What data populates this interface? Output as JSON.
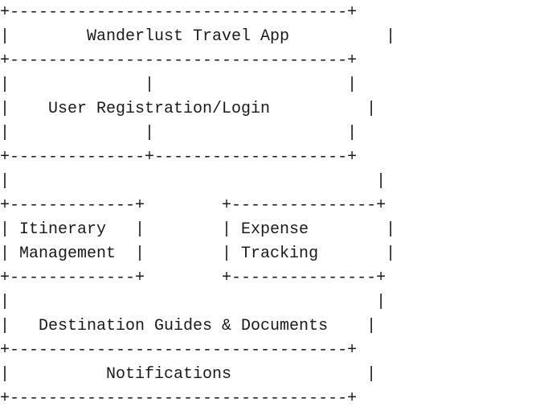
{
  "diagram": {
    "lines": [
      "+-----------------------------------+",
      "|        Wanderlust Travel App          |",
      "+-----------------------------------+",
      "|              |                    |",
      "|    User Registration/Login          |",
      "|              |                    |",
      "+--------------+--------------------+",
      "|                                      |",
      "+-------------+        +---------------+",
      "| Itinerary   |        | Expense        |",
      "| Management  |        | Tracking       |",
      "+-------------+        +---------------+",
      "|                                      |",
      "|   Destination Guides & Documents    |",
      "+-----------------------------------+",
      "|          Notifications              |",
      "+-----------------------------------+"
    ]
  }
}
